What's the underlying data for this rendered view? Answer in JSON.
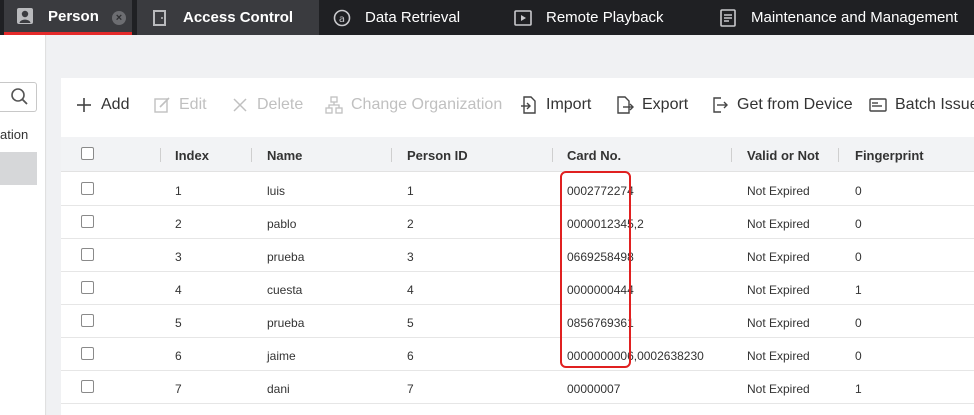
{
  "tabs": {
    "person": "Person",
    "access_control": "Access Control",
    "data_retrieval": "Data Retrieval",
    "remote_playback": "Remote Playback",
    "maintenance": "Maintenance and Management"
  },
  "left_panel": {
    "partial_label": "ation"
  },
  "toolbar": {
    "add": "Add",
    "edit": "Edit",
    "delete": "Delete",
    "change_org": "Change Organization",
    "import": "Import",
    "export": "Export",
    "get_from_device": "Get from Device",
    "batch_issue": "Batch Issue C"
  },
  "table": {
    "columns": [
      "Index",
      "Name",
      "Person ID",
      "Card No.",
      "Valid or Not",
      "Fingerprint"
    ],
    "rows": [
      {
        "index": "1",
        "name": "luis",
        "person_id": "1",
        "card": "0002772274",
        "valid": "Not Expired",
        "fingerprint": "0"
      },
      {
        "index": "2",
        "name": "pablo",
        "person_id": "2",
        "card": "0000012345,2",
        "valid": "Not Expired",
        "fingerprint": "0"
      },
      {
        "index": "3",
        "name": "prueba",
        "person_id": "3",
        "card": "0669258498",
        "valid": "Not Expired",
        "fingerprint": "0"
      },
      {
        "index": "4",
        "name": "cuesta",
        "person_id": "4",
        "card": "0000000444",
        "valid": "Not Expired",
        "fingerprint": "1"
      },
      {
        "index": "5",
        "name": "prueba",
        "person_id": "5",
        "card": "0856769361",
        "valid": "Not Expired",
        "fingerprint": "0"
      },
      {
        "index": "6",
        "name": "jaime",
        "person_id": "6",
        "card": "0000000006,0002638230",
        "valid": "Not Expired",
        "fingerprint": "0"
      },
      {
        "index": "7",
        "name": "dani",
        "person_id": "7",
        "card": "00000007",
        "valid": "Not Expired",
        "fingerprint": "1"
      }
    ]
  },
  "colors": {
    "topbar": "#1f2023",
    "active_tab": "#3a3b3f",
    "accent_red": "#e42a2a",
    "highlight": "#e02020"
  }
}
